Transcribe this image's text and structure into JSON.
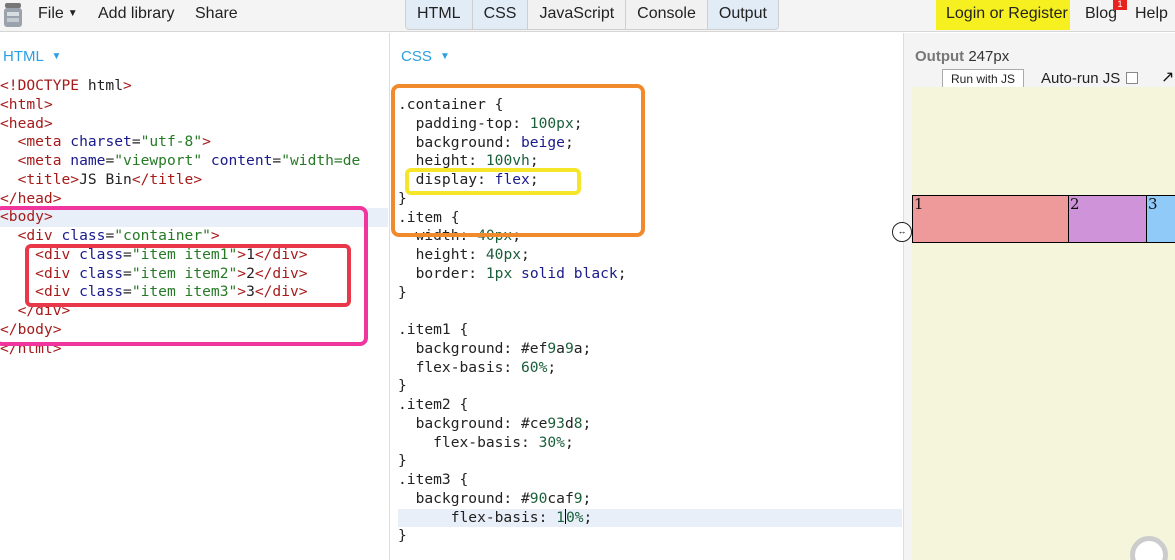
{
  "menu": {
    "file": "File",
    "add_library": "Add library",
    "share": "Share"
  },
  "tabs": [
    "HTML",
    "CSS",
    "JavaScript",
    "Console",
    "Output"
  ],
  "right_menu": {
    "login": "Login or Register",
    "blog": "Blog",
    "blog_badge": "1",
    "help": "Help"
  },
  "html_panel": {
    "label": "HTML",
    "lines": [
      "<!DOCTYPE html>",
      "<html>",
      "<head>",
      "  <meta charset=\"utf-8\">",
      "  <meta name=\"viewport\" content=\"width=de",
      "  <title>JS Bin</title>",
      "</head>",
      "<body>",
      "  <div class=\"container\">",
      "    <div class=\"item item1\">1</div>",
      "    <div class=\"item item2\">2</div>",
      "    <div class=\"item item3\">3</div>",
      "  </div>",
      "</body>",
      "</html>"
    ]
  },
  "css_panel": {
    "label": "CSS",
    "lines": [
      ".container {",
      "  padding-top: 100px;",
      "  background: beige;",
      "  height: 100vh;",
      "  display: flex;",
      "}",
      ".item {",
      "  width: 40px;",
      "  height: 40px;",
      "  border: 1px solid black;",
      "}",
      "",
      ".item1 {",
      "  background: #ef9a9a;",
      "  flex-basis: 60%;",
      "}",
      ".item2 {",
      "  background: #ce93d8;",
      "    flex-basis: 30%;",
      "}",
      ".item3 {",
      "  background: #90caf9;",
      "      flex-basis: 10%;",
      "}"
    ]
  },
  "output_panel": {
    "label": "Output",
    "width_readout": "247px",
    "run_button": "Run with JS",
    "autorun_label": "Auto-run JS",
    "items": [
      {
        "label": "1",
        "color": "#ef9a9a",
        "basis_percent": 60
      },
      {
        "label": "2",
        "color": "#ce93d8",
        "basis_percent": 30
      },
      {
        "label": "3",
        "color": "#90caf9",
        "basis_percent": 10
      }
    ],
    "frame_background": "beige"
  },
  "colors": {
    "label_blue": "#2aa0e0",
    "login_bg": "#f7f020",
    "annotation_pink": "#f0359e",
    "annotation_red": "#e8384a",
    "annotation_orange": "#f08a2c",
    "annotation_yellow": "#f5e62a"
  }
}
